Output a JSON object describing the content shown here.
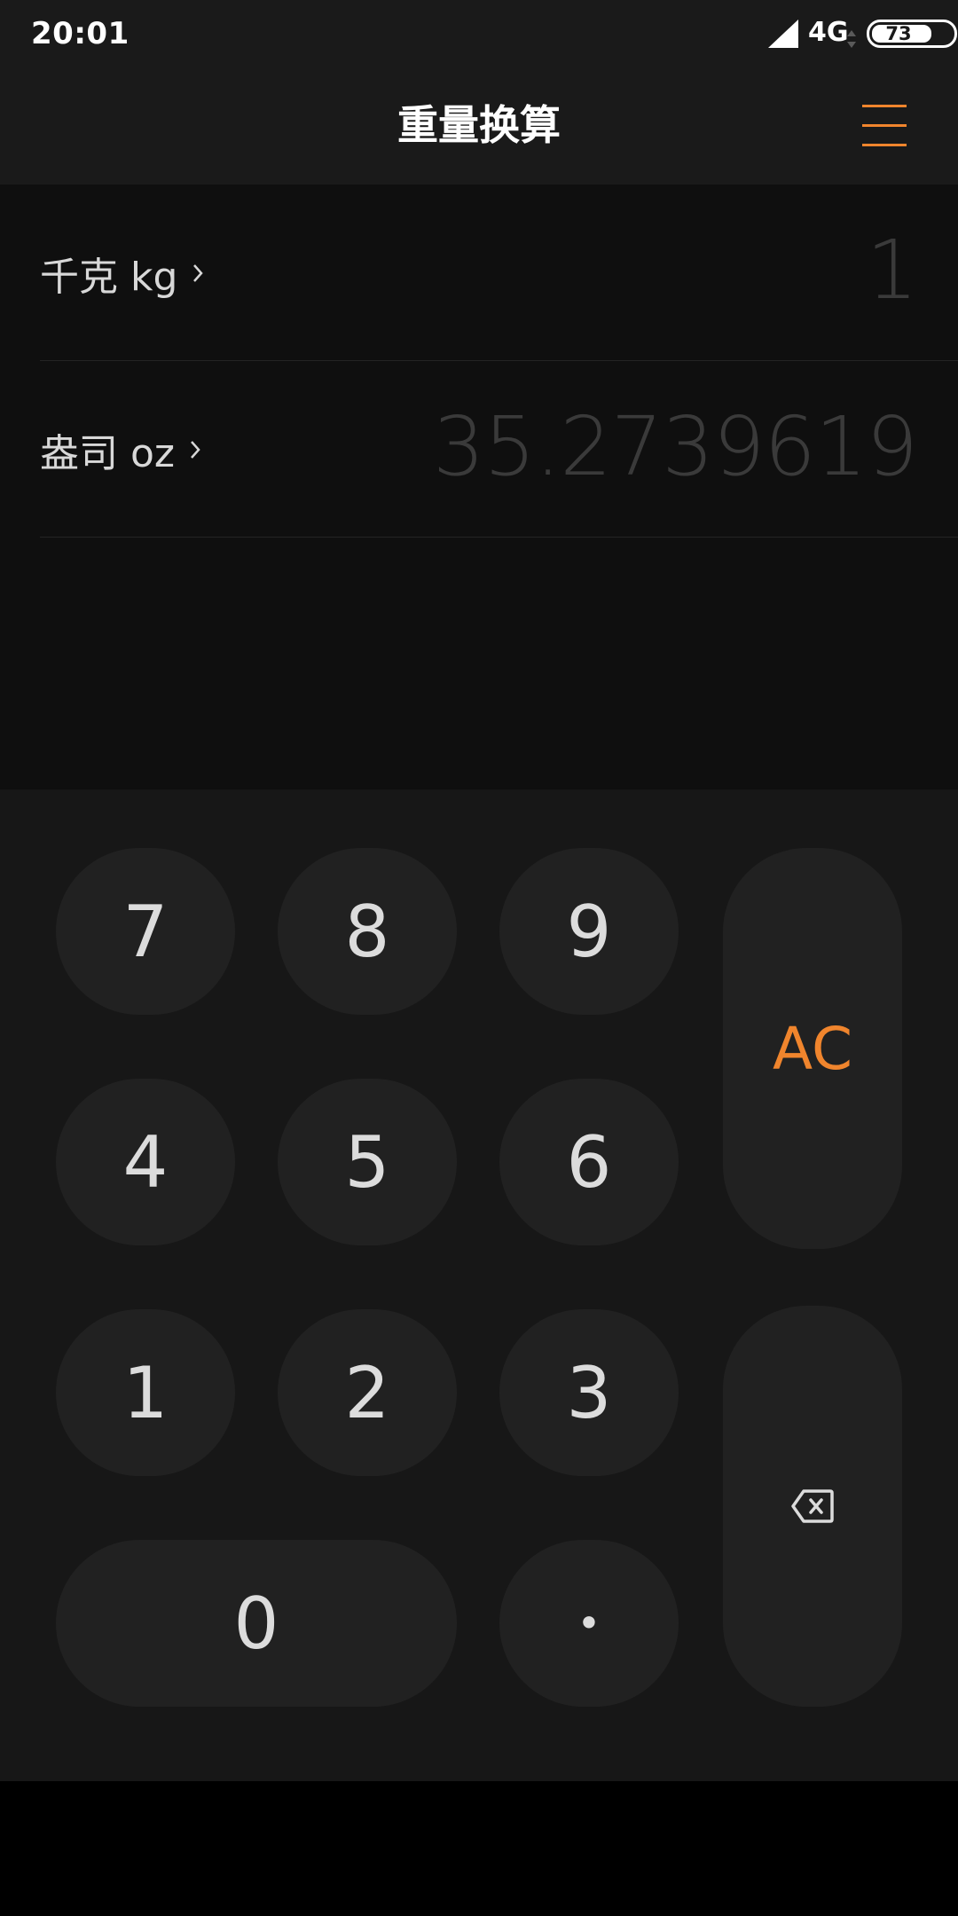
{
  "status_bar": {
    "time": "20:01",
    "network": "4G",
    "battery": "73"
  },
  "header": {
    "title": "重量换算"
  },
  "conversion": {
    "rows": [
      {
        "unit": "千克 kg",
        "value": "1"
      },
      {
        "unit": "盎司 oz",
        "value": "35.2739619"
      }
    ]
  },
  "keypad": {
    "keys": {
      "k7": "7",
      "k8": "8",
      "k9": "9",
      "k4": "4",
      "k5": "5",
      "k6": "6",
      "k1": "1",
      "k2": "2",
      "k3": "3",
      "k0": "0",
      "dot": "•",
      "clear": "AC"
    }
  },
  "colors": {
    "accent": "#f0852d",
    "background": "#0f0f0f",
    "key_bg": "#212121"
  },
  "icons": {
    "menu": "menu-icon",
    "backspace": "backspace-icon",
    "chevron": "chevron-right-icon",
    "signal": "signal-icon",
    "battery": "battery-icon"
  }
}
